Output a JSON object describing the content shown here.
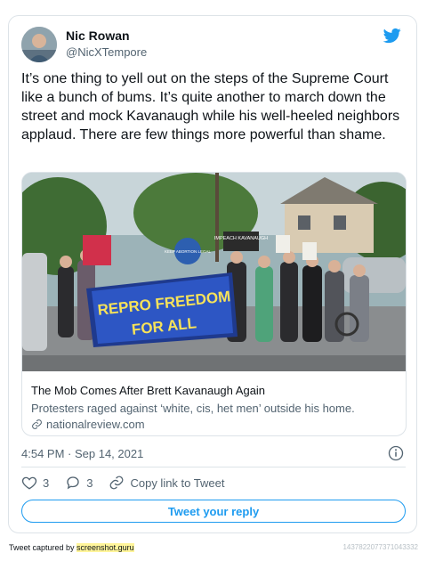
{
  "author": {
    "name": "Nic Rowan",
    "handle": "@NicXTempore"
  },
  "tweet": {
    "text": "It’s one thing to yell out on the steps of the Supreme Court like a bunch of bums. It’s quite another to march down the street and mock Kavanaugh while his well-heeled neighbors applaud. There are few things more powerful than shame."
  },
  "link_card": {
    "title": "The Mob Comes After Brett Kavanaugh Again",
    "description": "Protesters raged against ‘white, cis, het men’ outside his home.",
    "domain": "nationalreview.com",
    "image": {
      "banner_line1": "REPRO FREEDOM",
      "banner_line2": "FOR ALL",
      "sign_impeach": "IMPEACH KAVANAUGH",
      "sign_keep": "KEEP ABORTION LEGAL"
    }
  },
  "timestamp": "4:54 PM · Sep 14, 2021",
  "actions": {
    "likes": "3",
    "replies": "3",
    "copy_link": "Copy link to Tweet"
  },
  "reply_button": "Tweet your reply",
  "footer": {
    "captured_prefix": "Tweet captured by ",
    "captured_by": "screenshot.guru",
    "tweet_id": "1437822077371043332"
  },
  "colors": {
    "accent": "#1d9bf0",
    "text": "#0f1419",
    "muted": "#536471",
    "border": "#dde3e8"
  }
}
